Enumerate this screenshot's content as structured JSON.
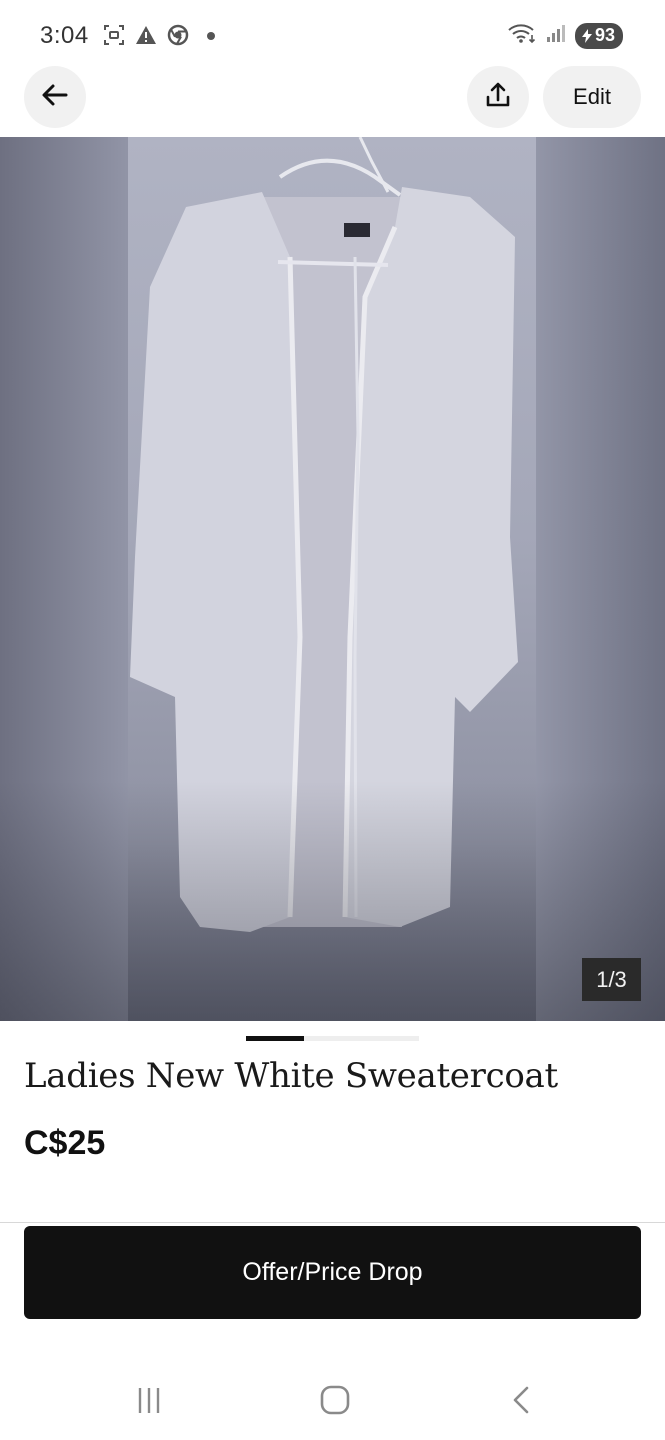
{
  "status_bar": {
    "time": "3:04",
    "battery": "93",
    "icons_left": [
      "screenshot-icon",
      "alert-icon",
      "chrome-icon",
      "dot-icon"
    ],
    "icons_right": [
      "wifi-icon",
      "signal-icon",
      "battery-icon"
    ]
  },
  "top_nav": {
    "edit_label": "Edit",
    "icons": [
      "back-arrow-icon",
      "share-icon"
    ]
  },
  "photo": {
    "counter": "1/3",
    "current_index": 1,
    "total": 3
  },
  "listing": {
    "title": "Ladies New White Sweatercoat",
    "price": "C$25"
  },
  "actions": {
    "offer_label": "Offer/Price Drop"
  },
  "system_nav": {
    "icons": [
      "recents-icon",
      "home-icon",
      "back-icon"
    ]
  },
  "colors": {
    "primary_button": "#111111",
    "chip_background": "#f1f1f1",
    "indicator_active": "#111111",
    "indicator_track": "#eeeeee"
  }
}
